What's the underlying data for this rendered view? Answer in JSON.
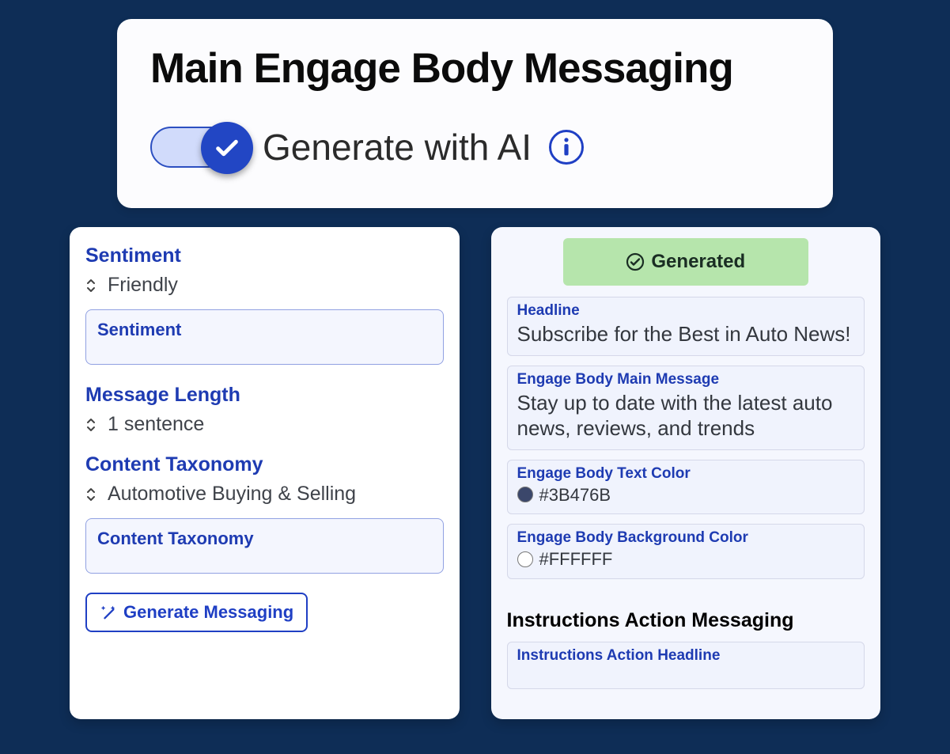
{
  "header": {
    "title": "Main Engage Body Messaging",
    "toggle_label": "Generate with AI"
  },
  "left": {
    "sentiment_label": "Sentiment",
    "sentiment_value": "Friendly",
    "sentiment_box_label": "Sentiment",
    "msg_length_label": "Message Length",
    "msg_length_value": "1 sentence",
    "taxonomy_label": "Content Taxonomy",
    "taxonomy_value": "Automotive Buying & Selling",
    "taxonomy_box_label": "Content Taxonomy",
    "generate_btn": "Generate Messaging"
  },
  "right": {
    "status": "Generated",
    "headline_label": "Headline",
    "headline_value": "Subscribe for the Best in Auto News!",
    "main_msg_label": "Engage Body Main Message",
    "main_msg_value": "Stay up to date with the latest auto news, reviews, and trends",
    "text_color_label": "Engage Body Text Color",
    "text_color_value": "#3B476B",
    "bg_color_label": "Engage Body Background Color",
    "bg_color_value": "#FFFFFF",
    "instructions_heading": "Instructions Action Messaging",
    "instructions_headline_label": "Instructions Action Headline"
  }
}
